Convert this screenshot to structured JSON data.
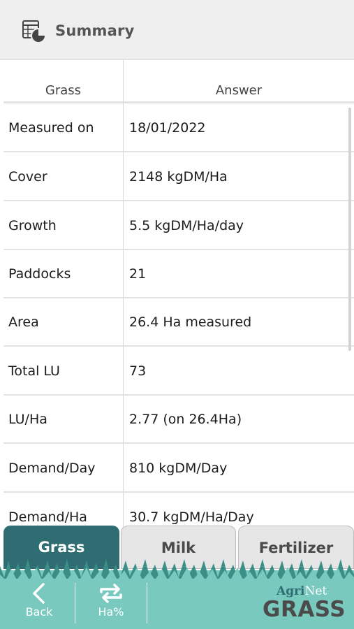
{
  "header": {
    "title": "Summary",
    "icon": "table-pie-icon"
  },
  "table": {
    "columns": [
      "Grass",
      "Answer"
    ],
    "rows": [
      {
        "label": "Measured on",
        "value": "18/01/2022"
      },
      {
        "label": "Cover",
        "value": "2148 kgDM/Ha"
      },
      {
        "label": "Growth",
        "value": "5.5 kgDM/Ha/day"
      },
      {
        "label": "Paddocks",
        "value": "21"
      },
      {
        "label": "Area",
        "value": "26.4 Ha measured"
      },
      {
        "label": "Total LU",
        "value": "73"
      },
      {
        "label": "LU/Ha",
        "value": "2.77 (on 26.4Ha)"
      },
      {
        "label": "Demand/Day",
        "value": "810 kgDM/Day"
      },
      {
        "label": "Demand/Ha",
        "value": "30.7 kgDM/Ha/Day"
      }
    ]
  },
  "tabs": [
    {
      "label": "Grass",
      "active": true
    },
    {
      "label": "Milk",
      "active": false
    },
    {
      "label": "Fertilizer",
      "active": false
    }
  ],
  "footer": {
    "back_label": "Back",
    "back_icon": "chevron-left-icon",
    "ha_label": "Ha%",
    "ha_icon": "swap-arrows-icon",
    "brand_top_agri": "Agri",
    "brand_top_net": "Net",
    "brand_bottom": "GRASS"
  },
  "colors": {
    "active_tab": "#2f6d73",
    "footer": "#79c9bf",
    "grass_dark": "#3b8f86"
  }
}
